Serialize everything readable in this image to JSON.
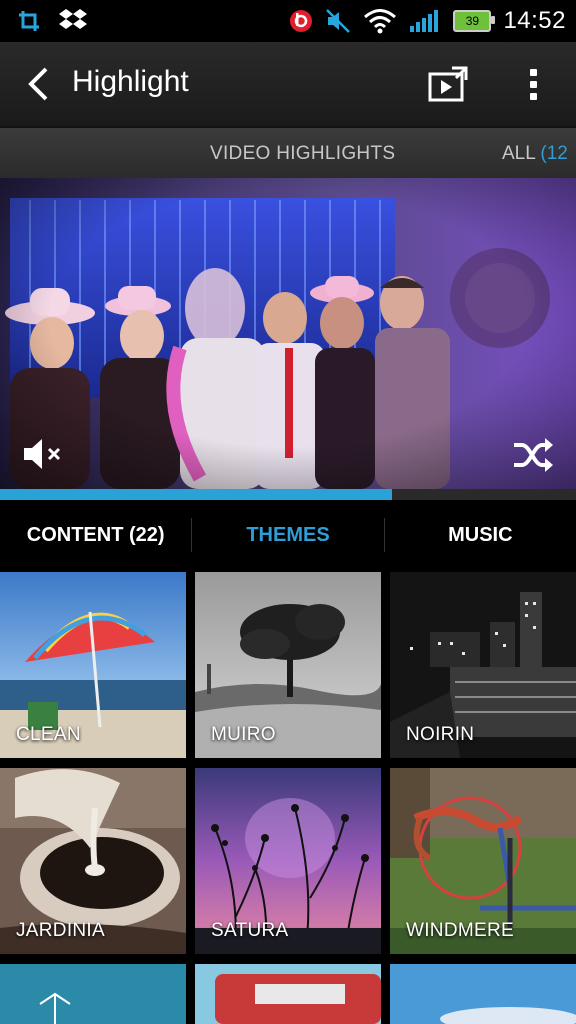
{
  "status_bar": {
    "time": "14:52",
    "battery_level": "39",
    "icons": [
      "screenshot-icon",
      "dropbox-icon",
      "beats-audio-icon",
      "muted-icon",
      "wifi-icon",
      "signal-icon",
      "battery-icon"
    ]
  },
  "action_bar": {
    "title": "Highlight",
    "back_icon": "back-arrow-icon",
    "export_icon": "export-video-icon",
    "overflow_icon": "overflow-menu-icon"
  },
  "sub_tabs": {
    "video_highlights": "VIDEO HIGHLIGHTS",
    "all_label": "ALL",
    "all_count": "(12"
  },
  "preview": {
    "mute_icon": "volume-mute-icon",
    "shuffle_icon": "shuffle-icon",
    "progress": 0.68
  },
  "section_tabs": {
    "content": "CONTENT (22)",
    "themes": "THEMES",
    "music": "MUSIC",
    "active": "themes"
  },
  "themes": {
    "items": [
      {
        "label": "CLEAN"
      },
      {
        "label": "MUIRO"
      },
      {
        "label": "NOIRIN"
      },
      {
        "label": "JARDINIA"
      },
      {
        "label": "SATURA",
        "selected": true
      },
      {
        "label": "WINDMERE"
      }
    ]
  },
  "colors": {
    "accent": "#2f9dd6",
    "background": "#000000"
  }
}
